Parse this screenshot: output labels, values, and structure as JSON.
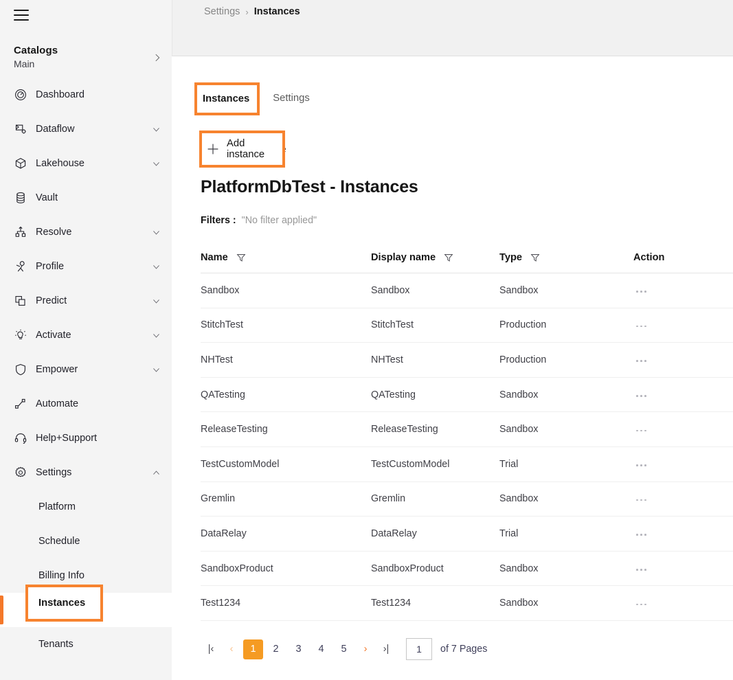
{
  "app": {
    "accent_orange": "#f4782a",
    "annotation_orange": "#f7832f",
    "sidebar_bg": "#f4f4f4",
    "topbar_bg": "#f1f1f1"
  },
  "sidebar": {
    "menu_icon": "hamburger-icon",
    "catalogs": {
      "title": "Catalogs",
      "subtitle": "Main",
      "chevron": "chevron-right-icon"
    },
    "items": [
      {
        "label": "Dashboard",
        "icon": "dashboard-icon",
        "expandable": false
      },
      {
        "label": "Dataflow",
        "icon": "dataflow-icon",
        "expandable": true
      },
      {
        "label": "Lakehouse",
        "icon": "lakehouse-icon",
        "expandable": true
      },
      {
        "label": "Vault",
        "icon": "vault-icon",
        "expandable": false
      },
      {
        "label": "Resolve",
        "icon": "resolve-icon",
        "expandable": true
      },
      {
        "label": "Profile",
        "icon": "profile-icon",
        "expandable": true
      },
      {
        "label": "Predict",
        "icon": "predict-icon",
        "expandable": true
      },
      {
        "label": "Activate",
        "icon": "activate-icon",
        "expandable": true
      },
      {
        "label": "Empower",
        "icon": "empower-icon",
        "expandable": true
      },
      {
        "label": "Automate",
        "icon": "automate-icon",
        "expandable": false
      },
      {
        "label": "Help+Support",
        "icon": "help-support-icon",
        "expandable": false
      },
      {
        "label": "Settings",
        "icon": "settings-gear-icon",
        "expandable": true,
        "expanded": true
      }
    ],
    "sub_items": [
      {
        "label": "Platform",
        "active": false
      },
      {
        "label": "Schedule",
        "active": false
      },
      {
        "label": "Billing Info",
        "active": false
      },
      {
        "label": "Instances",
        "active": true
      },
      {
        "label": "Tenants",
        "active": false
      }
    ]
  },
  "breadcrumb": {
    "parent": "Settings",
    "separator": "›",
    "current": "Instances"
  },
  "main": {
    "tabs": [
      {
        "label": "Instances",
        "active": true
      },
      {
        "label": "Settings",
        "active": false
      }
    ],
    "add_button": {
      "label": "Add instance",
      "icon": "plus-icon"
    },
    "page_title": "PlatformDbTest - Instances",
    "filters": {
      "label": "Filters :",
      "value": "\"No filter applied\""
    },
    "table": {
      "columns": [
        {
          "label": "Name",
          "filter_icon": "funnel-icon"
        },
        {
          "label": "Display name",
          "filter_icon": "funnel-icon"
        },
        {
          "label": "Type",
          "filter_icon": "funnel-icon"
        },
        {
          "label": "Action",
          "filter_icon": null
        }
      ],
      "rows": [
        {
          "name": "Sandbox",
          "display": "Sandbox",
          "type": "Sandbox"
        },
        {
          "name": "StitchTest",
          "display": "StitchTest",
          "type": "Production"
        },
        {
          "name": "NHTest",
          "display": "NHTest",
          "type": "Production"
        },
        {
          "name": "QATesting",
          "display": "QATesting",
          "type": "Sandbox"
        },
        {
          "name": "ReleaseTesting",
          "display": "ReleaseTesting",
          "type": "Sandbox"
        },
        {
          "name": "TestCustomModel",
          "display": "TestCustomModel",
          "type": "Trial"
        },
        {
          "name": "Gremlin",
          "display": "Gremlin",
          "type": "Sandbox"
        },
        {
          "name": "DataRelay",
          "display": "DataRelay",
          "type": "Trial"
        },
        {
          "name": "SandboxProduct",
          "display": "SandboxProduct",
          "type": "Sandbox"
        },
        {
          "name": "Test1234",
          "display": "Test1234",
          "type": "Sandbox"
        }
      ],
      "row_action_icon": "ellipsis-icon"
    },
    "pagination": {
      "first": "|‹",
      "prev": "‹",
      "next": "›",
      "last": "›|",
      "pages": [
        "1",
        "2",
        "3",
        "4",
        "5"
      ],
      "current_page": "1",
      "input_value": "1",
      "of_pages_text": "of 7 Pages"
    }
  },
  "annotations": {
    "tab_label": "Instances",
    "add_label": "Add instance",
    "sidebar_label": "Instances"
  }
}
